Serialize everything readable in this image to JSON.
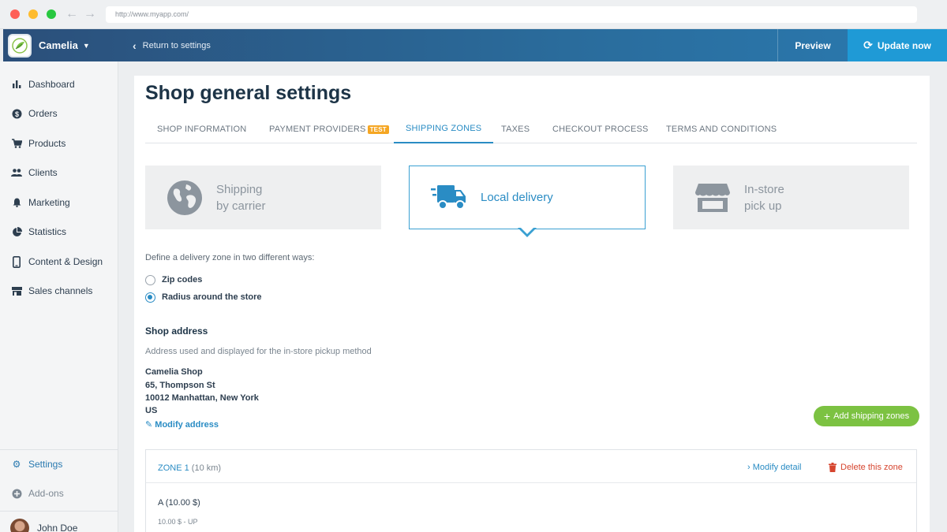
{
  "browser": {
    "url": "http://www.myapp.com/"
  },
  "appbar": {
    "brand_name": "Camelia",
    "return_label": "Return to settings",
    "preview_label": "Preview",
    "update_label": "Update now"
  },
  "sidebar": {
    "items": [
      {
        "label": "Dashboard",
        "icon": "bar-chart-icon"
      },
      {
        "label": "Orders",
        "icon": "dollar-circle-icon"
      },
      {
        "label": "Products",
        "icon": "cart-icon"
      },
      {
        "label": "Clients",
        "icon": "users-icon"
      },
      {
        "label": "Marketing",
        "icon": "bell-icon"
      },
      {
        "label": "Statistics",
        "icon": "pie-chart-icon"
      },
      {
        "label": "Content & Design",
        "icon": "phone-icon"
      },
      {
        "label": "Sales channels",
        "icon": "store-icon"
      }
    ],
    "settings_label": "Settings",
    "addons_label": "Add-ons",
    "user_name": "John Doe"
  },
  "page": {
    "title": "Shop general settings",
    "tabs": [
      {
        "label": "SHOP INFORMATION"
      },
      {
        "label": "PAYMENT PROVIDERS",
        "badge": "TEST"
      },
      {
        "label": "SHIPPING ZONES"
      },
      {
        "label": "TAXES"
      },
      {
        "label": "CHECKOUT PROCESS"
      },
      {
        "label": "TERMS AND CONDITIONS"
      }
    ],
    "active_tab": "SHIPPING ZONES"
  },
  "methods": [
    {
      "line1": "Shipping",
      "line2": "by carrier",
      "icon": "globe-icon",
      "selected": false
    },
    {
      "line1": "Local delivery",
      "line2": "",
      "icon": "truck-icon",
      "selected": true
    },
    {
      "line1": "In-store",
      "line2": "pick up",
      "icon": "storefront-icon",
      "selected": false
    }
  ],
  "delivery": {
    "define_text": "Define a delivery zone in two different ways:",
    "option_zip": "Zip codes",
    "option_radius": "Radius around the store",
    "selected_option": "Radius around the store"
  },
  "address": {
    "title": "Shop address",
    "subtitle": "Address used and displayed for the in-store pickup method",
    "lines": [
      "Camelia Shop",
      "65, Thompson St",
      "10012 Manhattan, New York",
      "US"
    ],
    "modify_label": "Modify address"
  },
  "zones": {
    "add_label": "Add shipping zones",
    "items": [
      {
        "name": "ZONE 1",
        "distance": "(10 km)",
        "modify_label": "Modify detail",
        "delete_label": "Delete this zone",
        "rate": "A (10.00 $)",
        "range": "10.00 $ - UP"
      }
    ]
  },
  "colors": {
    "accent": "#2a8cc4",
    "update_button": "#1f9ad6",
    "add_button": "#7cc242",
    "delete": "#d6452f",
    "badge": "#f5a623"
  }
}
